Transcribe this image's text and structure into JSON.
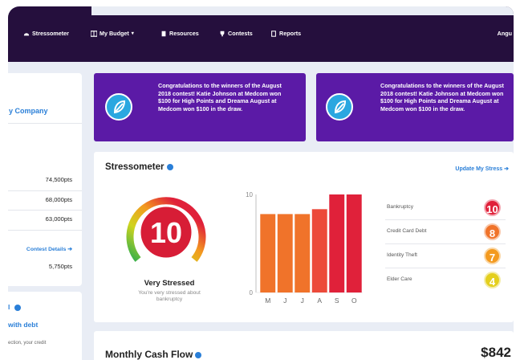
{
  "nav": {
    "items": [
      {
        "label": "Stressometer",
        "icon": "gauge-icon"
      },
      {
        "label": "My Budget",
        "icon": "grid-icon",
        "has_caret": true
      },
      {
        "label": "Resources",
        "icon": "book-icon"
      },
      {
        "label": "Contests",
        "icon": "trophy-icon"
      },
      {
        "label": "Reports",
        "icon": "report-icon"
      }
    ],
    "user_label": "Angu"
  },
  "sidebar": {
    "company": "y Company",
    "scores": [
      "74,500pts",
      "68,000pts",
      "63,000pts"
    ],
    "contest_details": "Contest Details",
    "my_points": "5,750pts",
    "card2_title": "l",
    "card2_subtitle": "with debt",
    "card2_text": "ection, your credit"
  },
  "banners": [
    {
      "text": "Congratulations to the winners of the August 2018 contest! Katie Johnson at Medcom won $100 for High Points and Dreama August at Medcom won $100 in the draw."
    },
    {
      "text": "Congratulations to the winners of the August 2018 contest! Katie Johnson at Medcom won $100 for High Points and Dreama August at Medcom won $100 in the draw."
    }
  ],
  "stressometer": {
    "title": "Stressometer",
    "update_label": "Update My Stress",
    "level": "10",
    "level_label": "Very Stressed",
    "level_subtext": "You're very stressed about bankruptcy",
    "rankings": [
      {
        "label": "Bankruptcy",
        "value": "10",
        "color": "#e0213a"
      },
      {
        "label": "Credit Card Debt",
        "value": "8",
        "color": "#f0732a"
      },
      {
        "label": "Identity Theft",
        "value": "7",
        "color": "#f39a1f"
      },
      {
        "label": "Elder Care",
        "value": "4",
        "color": "#e4cf1e"
      }
    ]
  },
  "chart_data": {
    "type": "bar",
    "categories": [
      "M",
      "J",
      "J",
      "A",
      "S",
      "O"
    ],
    "values": [
      8,
      8,
      8,
      8.5,
      10,
      10
    ],
    "colors": [
      "#f0732a",
      "#f0732a",
      "#f0732a",
      "#ec4a3a",
      "#e0213a",
      "#e0213a"
    ],
    "ylim": [
      0,
      10
    ],
    "y_ticks": [
      "0",
      "10"
    ]
  },
  "cash_flow": {
    "title": "Monthly Cash Flow",
    "amount": "$842"
  }
}
